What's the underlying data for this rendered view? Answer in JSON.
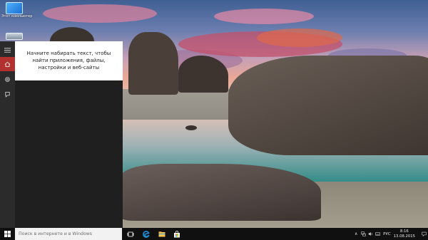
{
  "desktop": {
    "icons": [
      {
        "icon": "computer-icon",
        "label": "Этот компьютер"
      },
      {
        "icon": "recycle-bin-icon",
        "label": ""
      }
    ]
  },
  "start_panel": {
    "hint_text": "Начните набирать текст, чтобы найти приложения, файлы, настройки и веб-сайты",
    "rail": [
      "hamburger-icon",
      "home-icon",
      "settings-icon",
      "feedback-icon"
    ],
    "accent_color": "#b2302e"
  },
  "taskbar": {
    "search_placeholder": "Поиск в интернете и в Windows",
    "pinned": [
      "task-view-icon",
      "edge-icon",
      "file-explorer-icon",
      "store-icon"
    ],
    "tray": {
      "language": "РУС",
      "time": "8:16",
      "date": "13.08.2015"
    }
  }
}
